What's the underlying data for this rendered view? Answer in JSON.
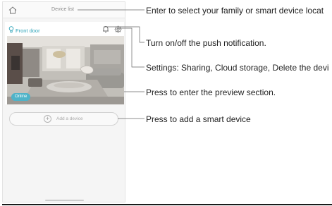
{
  "app": {
    "title": "Device list"
  },
  "device": {
    "name": "Front door",
    "status": "Online"
  },
  "add_device": {
    "label": "Add a device"
  },
  "annotations": {
    "select": "Enter to select your family or smart device locat",
    "notification": "Turn on/off the push notification.",
    "settings": "Settings: Sharing, Cloud storage, Delete the devi",
    "preview": "Press to enter the preview section.",
    "add": "Press to add a smart device"
  },
  "colors": {
    "accent": "#4fb3c8",
    "device_name": "#2da3b8"
  },
  "icons": [
    "home-icon",
    "bulb-icon",
    "bell-icon",
    "gear-icon",
    "plus-icon"
  ]
}
